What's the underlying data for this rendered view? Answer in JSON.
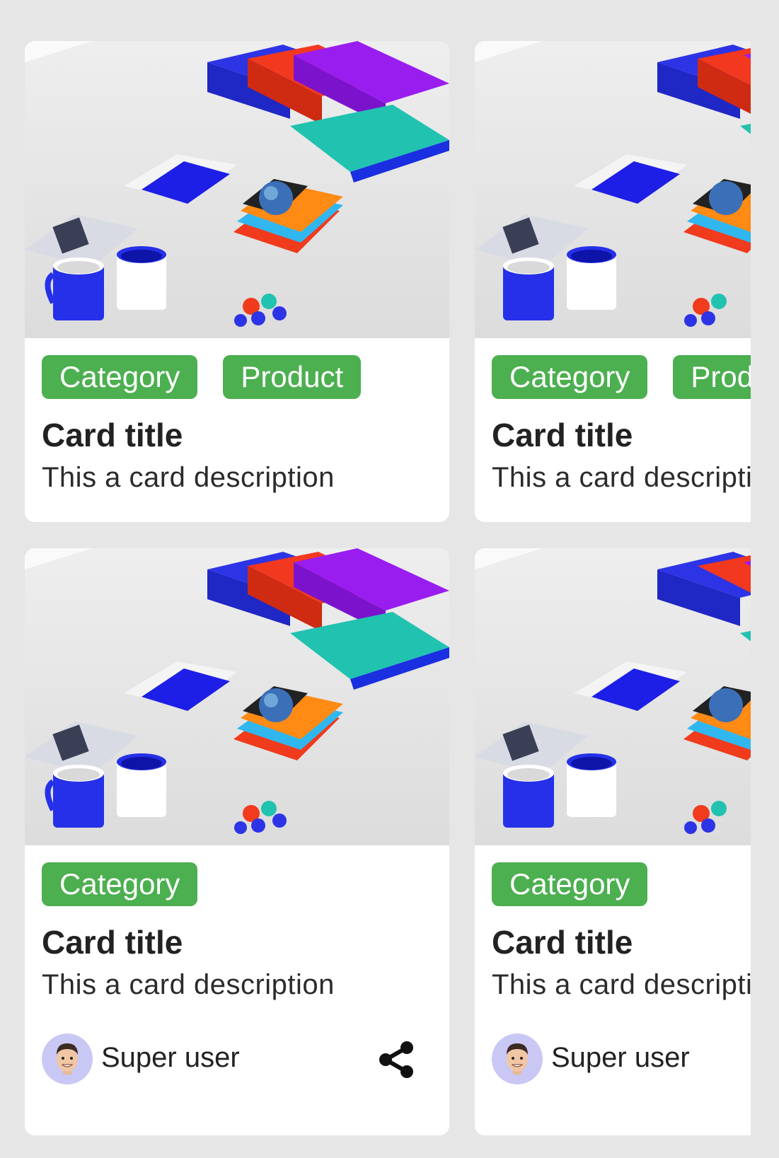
{
  "colors": {
    "tag_bg": "#4caf50",
    "page_bg": "#e6e6e6",
    "card_bg": "#ffffff",
    "avatar_bg": "#c9c7f4"
  },
  "cards": [
    {
      "tags": [
        "Category",
        "Product"
      ],
      "title": "Card title",
      "description": "This a card description"
    },
    {
      "tags": [
        "Category",
        "Product"
      ],
      "title": "Card title",
      "description": "This a card description"
    },
    {
      "tags": [
        "Category"
      ],
      "title": "Card title",
      "description": "This a card description",
      "user": "Super user",
      "share_icon": "share-icon"
    },
    {
      "tags": [
        "Category"
      ],
      "title": "Card title",
      "description": "This a card description",
      "user": "Super user"
    }
  ]
}
